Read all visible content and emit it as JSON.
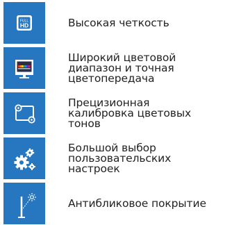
{
  "features": [
    {
      "icon": "full-hd-icon",
      "label": "Высокая четкость",
      "badge_top": "FULL",
      "badge_bottom": "HD"
    },
    {
      "icon": "color-gamut-monitor-icon",
      "label": "Широкий цветовой\nдиапазон и точная\nцветопередача"
    },
    {
      "icon": "calibration-monitor-icon",
      "label": "Прецизионная\nкалибровка цветовых\nтонов"
    },
    {
      "icon": "gears-icon",
      "label": "Большой выбор\nпользовательских\nнастроек"
    },
    {
      "icon": "anti-glare-icon",
      "label": "Антибликовое покрытие"
    }
  ],
  "colors": {
    "tile_background": "#2677bf",
    "icon_foreground": "#ffffff",
    "text": "#222222"
  }
}
